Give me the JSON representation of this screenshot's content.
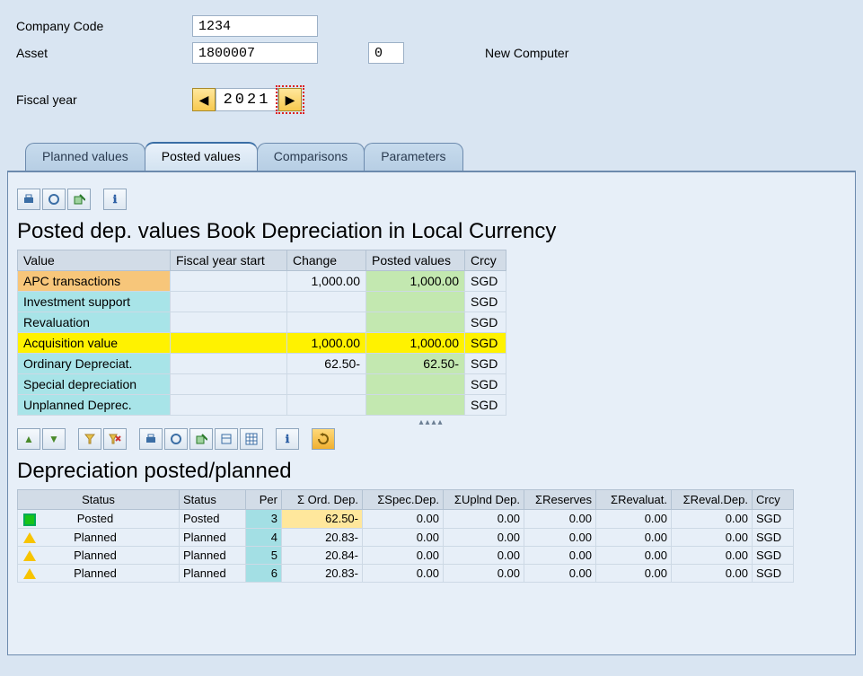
{
  "form": {
    "company_code_label": "Company Code",
    "company_code_value": "1234",
    "asset_label": "Asset",
    "asset_value": "1800007",
    "subnumber_value": "0",
    "asset_desc": "New Computer",
    "fiscal_year_label": "Fiscal year",
    "fiscal_year_value": "2021"
  },
  "tabs": [
    "Planned values",
    "Posted values",
    "Comparisons",
    "Parameters"
  ],
  "section1": {
    "title": "Posted dep. values Book Depreciation in Local Currency",
    "headers": [
      "Value",
      "Fiscal year start",
      "Change",
      "Posted values",
      "Crcy"
    ],
    "rows": [
      {
        "label": "APC transactions",
        "fys": "",
        "chg": "1,000.00",
        "pv": "1,000.00",
        "crcy": "SGD",
        "style": "orange_green"
      },
      {
        "label": "Investment support",
        "fys": "",
        "chg": "",
        "pv": "",
        "crcy": "SGD",
        "style": "cyan_green"
      },
      {
        "label": "Revaluation",
        "fys": "",
        "chg": "",
        "pv": "",
        "crcy": "SGD",
        "style": "cyan_green"
      },
      {
        "label": "Acquisition value",
        "fys": "",
        "chg": "1,000.00",
        "pv": "1,000.00",
        "crcy": "SGD",
        "style": "yellow_all"
      },
      {
        "label": "Ordinary Depreciat.",
        "fys": "",
        "chg": "62.50-",
        "pv": "62.50-",
        "crcy": "SGD",
        "style": "cyan_green"
      },
      {
        "label": "Special depreciation",
        "fys": "",
        "chg": "",
        "pv": "",
        "crcy": "SGD",
        "style": "cyan_green"
      },
      {
        "label": "Unplanned Deprec.",
        "fys": "",
        "chg": "",
        "pv": "",
        "crcy": "SGD",
        "style": "cyan_green"
      }
    ]
  },
  "section2": {
    "title": "Depreciation posted/planned",
    "headers": [
      "Status",
      "Status",
      "Per",
      "Σ Ord. Dep.",
      "ΣSpec.Dep.",
      "ΣUplnd Dep.",
      "ΣReserves",
      "ΣRevaluat.",
      "ΣReval.Dep.",
      "Crcy"
    ],
    "rows": [
      {
        "icon": "posted",
        "s1": "Posted",
        "s2": "Posted",
        "per": "3",
        "ord": "62.50-",
        "spec": "0.00",
        "upl": "0.00",
        "res": "0.00",
        "rev": "0.00",
        "revd": "0.00",
        "crcy": "SGD",
        "hl": true
      },
      {
        "icon": "planned",
        "s1": "Planned",
        "s2": "Planned",
        "per": "4",
        "ord": "20.83-",
        "spec": "0.00",
        "upl": "0.00",
        "res": "0.00",
        "rev": "0.00",
        "revd": "0.00",
        "crcy": "SGD",
        "hl": false
      },
      {
        "icon": "planned",
        "s1": "Planned",
        "s2": "Planned",
        "per": "5",
        "ord": "20.84-",
        "spec": "0.00",
        "upl": "0.00",
        "res": "0.00",
        "rev": "0.00",
        "revd": "0.00",
        "crcy": "SGD",
        "hl": false
      },
      {
        "icon": "planned",
        "s1": "Planned",
        "s2": "Planned",
        "per": "6",
        "ord": "20.83-",
        "spec": "0.00",
        "upl": "0.00",
        "res": "0.00",
        "rev": "0.00",
        "revd": "0.00",
        "crcy": "SGD",
        "hl": false
      }
    ]
  }
}
